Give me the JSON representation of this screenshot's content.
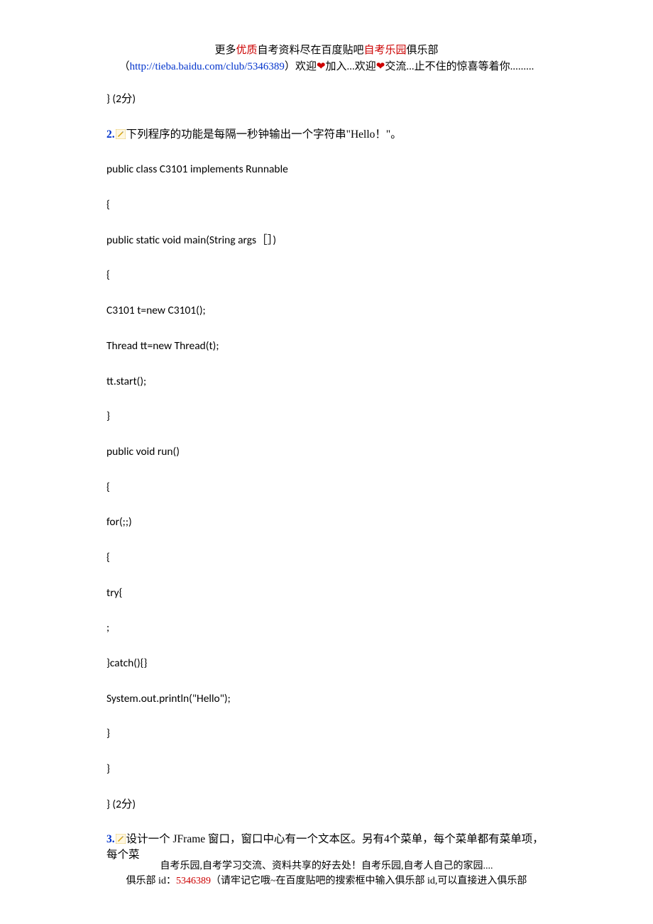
{
  "header": {
    "line1_pre": "更多",
    "line1_red1": "优质",
    "line1_mid": "自考资料尽在百度贴吧",
    "line1_red2": "自考乐园",
    "line1_post": "俱乐部",
    "line2_open": "（",
    "line2_url": "http://tieba.baidu.com/club/5346389",
    "line2_close": "）",
    "line2_a": "欢迎",
    "line2_b": "加入...欢迎",
    "line2_c": "交流...止不住的惊喜等着你........."
  },
  "body": {
    "p1": "} (2分)",
    "q2_num": "2.",
    "q2_text": "下列程序的功能是每隔一秒钟输出一个字符串\"Hello！\"。",
    "code": [
      "public class C3101 implements Runnable",
      "{",
      "public static void main(String args［］)",
      "{",
      "C3101 t=new C3101();",
      "Thread tt=new Thread(t);",
      "tt.start();",
      "}",
      "public void run()",
      "{",
      "for(;;)",
      "{",
      "try{",
      "  ;",
      "}catch(){}",
      "System.out.println(\"Hello\");",
      "}",
      "}",
      "} (2分)"
    ],
    "q3_num": "3.",
    "q3_text": "设计一个 JFrame 窗口，窗口中心有一个文本区。另有4个菜单，每个菜单都有菜单项，每个菜"
  },
  "footer": {
    "line1": "自考乐园,自考学习交流、资料共享的好去处！自考乐园,自考人自己的家园....",
    "line2_a": "俱乐部 id：",
    "line2_red": "5346389",
    "line2_b": "（请牢记它哦~在百度贴吧的搜索框中输入俱乐部 id,可以直接进入俱乐部"
  }
}
